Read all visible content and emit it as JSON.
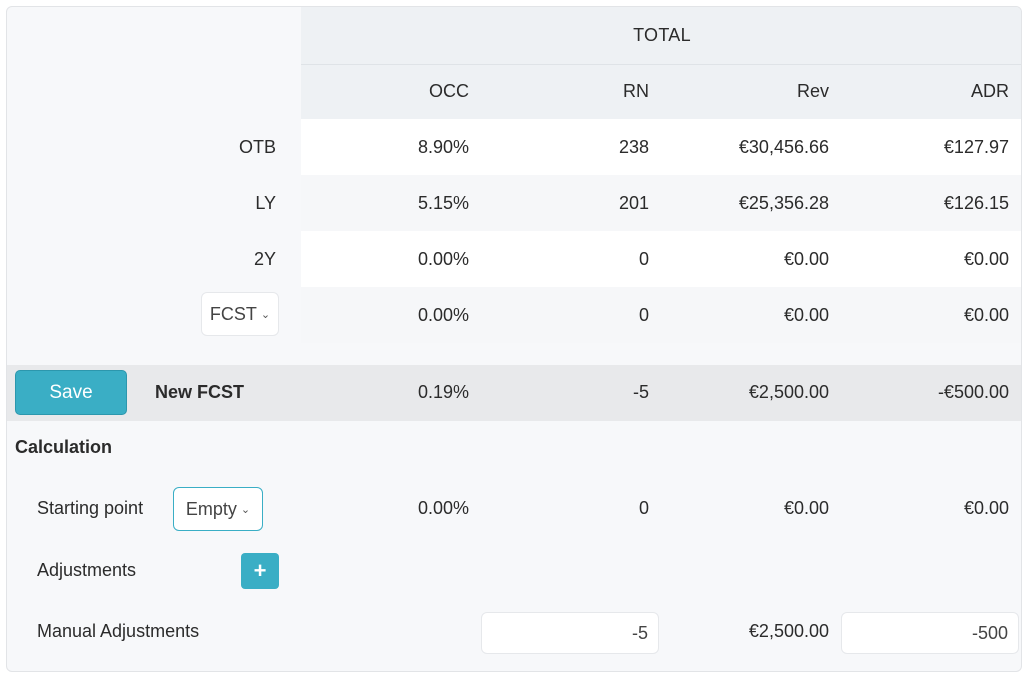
{
  "header": {
    "group_title": "TOTAL",
    "columns": [
      "OCC",
      "RN",
      "Rev",
      "ADR"
    ]
  },
  "rows": [
    {
      "label": "OTB",
      "occ": "8.90%",
      "rn": "238",
      "rev": "€30,456.66",
      "adr": "€127.97"
    },
    {
      "label": "LY",
      "occ": "5.15%",
      "rn": "201",
      "rev": "€25,356.28",
      "adr": "€126.15"
    },
    {
      "label": "2Y",
      "occ": "0.00%",
      "rn": "0",
      "rev": "€0.00",
      "adr": "€0.00"
    },
    {
      "label": "FCST",
      "occ": "0.00%",
      "rn": "0",
      "rev": "€0.00",
      "adr": "€0.00"
    }
  ],
  "new_fcst": {
    "save_label": "Save",
    "label": "New FCST",
    "occ": "0.19%",
    "rn": "-5",
    "rev": "€2,500.00",
    "adr": "-€500.00"
  },
  "calculation": {
    "title": "Calculation",
    "starting_point": {
      "label": "Starting point",
      "selected": "Empty",
      "occ": "0.00%",
      "rn": "0",
      "rev": "€0.00",
      "adr": "€0.00"
    },
    "adjustments": {
      "label": "Adjustments",
      "add_icon": "plus-icon"
    },
    "manual_adjustments": {
      "label": "Manual Adjustments",
      "rn_value": "-5",
      "rev": "€2,500.00",
      "adr_value": "-500"
    }
  },
  "colors": {
    "accent": "#3aaec5",
    "header_bg": "#eef1f4",
    "band_bg": "#e8e9eb"
  }
}
